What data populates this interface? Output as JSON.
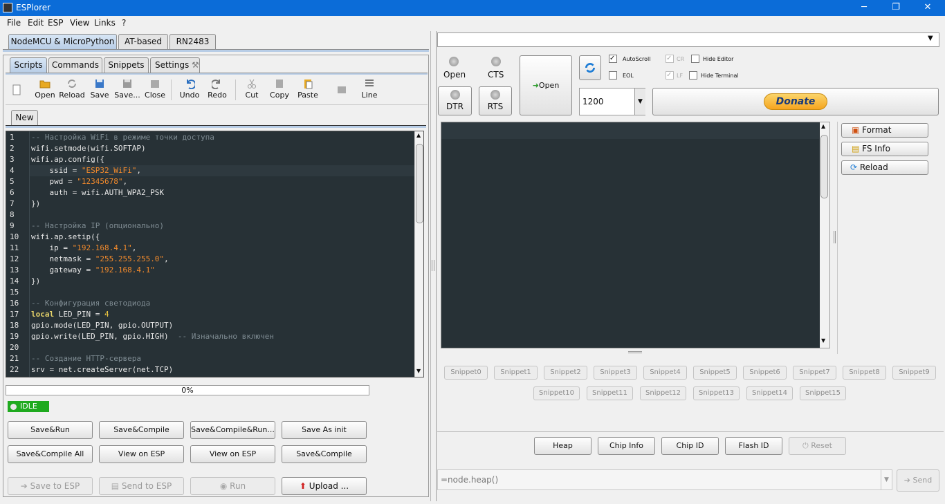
{
  "window": {
    "title": "ESPlorer",
    "min_icon": "minimize-icon",
    "max_icon": "maximize-icon",
    "close_icon": "close-icon",
    "min": "─",
    "max": "❐",
    "close": "✕"
  },
  "menu": [
    "File",
    "Edit",
    "ESP",
    "View",
    "Links",
    "?"
  ],
  "top_tabs": [
    "NodeMCU & MicroPython",
    "AT-based",
    "RN2483"
  ],
  "sub_tabs": [
    "Scripts",
    "Commands",
    "Snippets",
    "Settings"
  ],
  "toolbar": {
    "open": "Open",
    "reload": "Reload",
    "save": "Save",
    "save_as": "Save...",
    "close": "Close",
    "undo": "Undo",
    "redo": "Redo",
    "cut": "Cut",
    "copy": "Copy",
    "paste": "Paste",
    "line": "Line"
  },
  "file_tab": "New",
  "code_lines": [
    "-- Настройка WiFi в режиме точки доступа",
    "wifi.setmode(wifi.SOFTAP)",
    "wifi.ap.config({",
    "    ssid = \"ESP32_WiFi\",",
    "    pwd = \"12345678\",",
    "    auth = wifi.AUTH_WPA2_PSK",
    "})",
    "",
    "-- Настройка IP (опционально)",
    "wifi.ap.setip({",
    "    ip = \"192.168.4.1\",",
    "    netmask = \"255.255.255.0\",",
    "    gateway = \"192.168.4.1\"",
    "})",
    "",
    "-- Конфигурация светодиода",
    "local LED_PIN = 4",
    "gpio.mode(LED_PIN, gpio.OUTPUT)",
    "gpio.write(LED_PIN, gpio.HIGH)  -- Изначально включен",
    "",
    "-- Создание HTTP-сервера",
    "srv = net.createServer(net.TCP)"
  ],
  "progress": {
    "value": 0,
    "label": "0%"
  },
  "status": "IDLE",
  "action_buttons_row1": [
    "Save&Run",
    "Save&Compile",
    "Save&Compile&Run...",
    "Save As init"
  ],
  "action_buttons_row2": [
    "Save&Compile All",
    "View on ESP",
    "View on ESP",
    "Save&Compile"
  ],
  "bottom_buttons": [
    "Save to ESP",
    "Send to ESP",
    "Run",
    "Upload ..."
  ],
  "port": {
    "open_label": "Open",
    "cts": "CTS",
    "dtr": "DTR",
    "rts": "RTS",
    "open_button": "Open",
    "baud": "1200",
    "autoscroll": "AutoScroll",
    "eol": "EOL",
    "cr": "CR",
    "lf": "LF",
    "hide_editor": "Hide Editor",
    "hide_terminal": "Hide Terminal",
    "donate": "Donate"
  },
  "side_buttons": [
    "Format",
    "FS Info",
    "Reload"
  ],
  "snippets_row1": [
    "Snippet0",
    "Snippet1",
    "Snippet2",
    "Snippet3",
    "Snippet4",
    "Snippet5",
    "Snippet6",
    "Snippet7",
    "Snippet8",
    "Snippet9"
  ],
  "snippets_row2": [
    "Snippet10",
    "Snippet11",
    "Snippet12",
    "Snippet13",
    "Snippet14",
    "Snippet15"
  ],
  "cmd_buttons": [
    "Heap",
    "Chip Info",
    "Chip ID",
    "Flash ID",
    "Reset"
  ],
  "command": {
    "value": "=node.heap()",
    "send": "Send"
  },
  "colors": {
    "titlebar": "#0b6cd8",
    "editor_bg": "#273136",
    "terminal_bg": "#273136",
    "idle": "#1faa1f",
    "donate": "#f5b51f"
  }
}
